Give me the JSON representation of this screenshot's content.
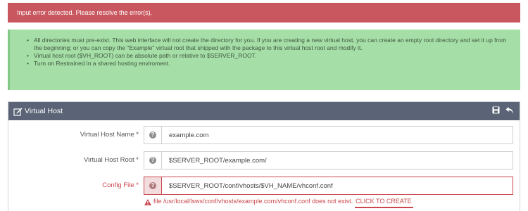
{
  "alert": {
    "message": "Input error detected. Please resolve the error(s).",
    "color": "#c9575f"
  },
  "info": {
    "items": [
      "All directories must pre-exist. This web interface will not create the directory for you. If you are creating a new virtual host, you can create an empty root directory and set it up from the beginning; or you can copy the \"Example\" virtual root that shipped with the package to this virtual host root and modify it.",
      "Virtual host root ($VH_ROOT) can be absolute path or relative to $SERVER_ROOT.",
      "Turn on Restrained in a shared hosting enviroment."
    ]
  },
  "panel": {
    "title": "Virtual Host",
    "header_color": "#5b6476",
    "icons": {
      "title": "edit-icon",
      "save": "save-icon",
      "back": "back-icon"
    }
  },
  "form": {
    "fields": [
      {
        "label": "Virtual Host Name *",
        "value": "example.com",
        "error": false
      },
      {
        "label": "Virtual Host Root *",
        "value": "$SERVER_ROOT/example.com/",
        "error": false
      },
      {
        "label": "Config File *",
        "value": "$SERVER_ROOT/conf/vhosts/$VH_NAME/vhconf.conf",
        "error": true
      }
    ],
    "help_icon": "help-icon",
    "error": {
      "icon": "warning-icon",
      "message": "file /usr/local/lsws/conf/vhosts/example.com/vhconf.conf does not exist.",
      "action": "CLICK TO CREATE",
      "color": "#c9484e"
    }
  }
}
